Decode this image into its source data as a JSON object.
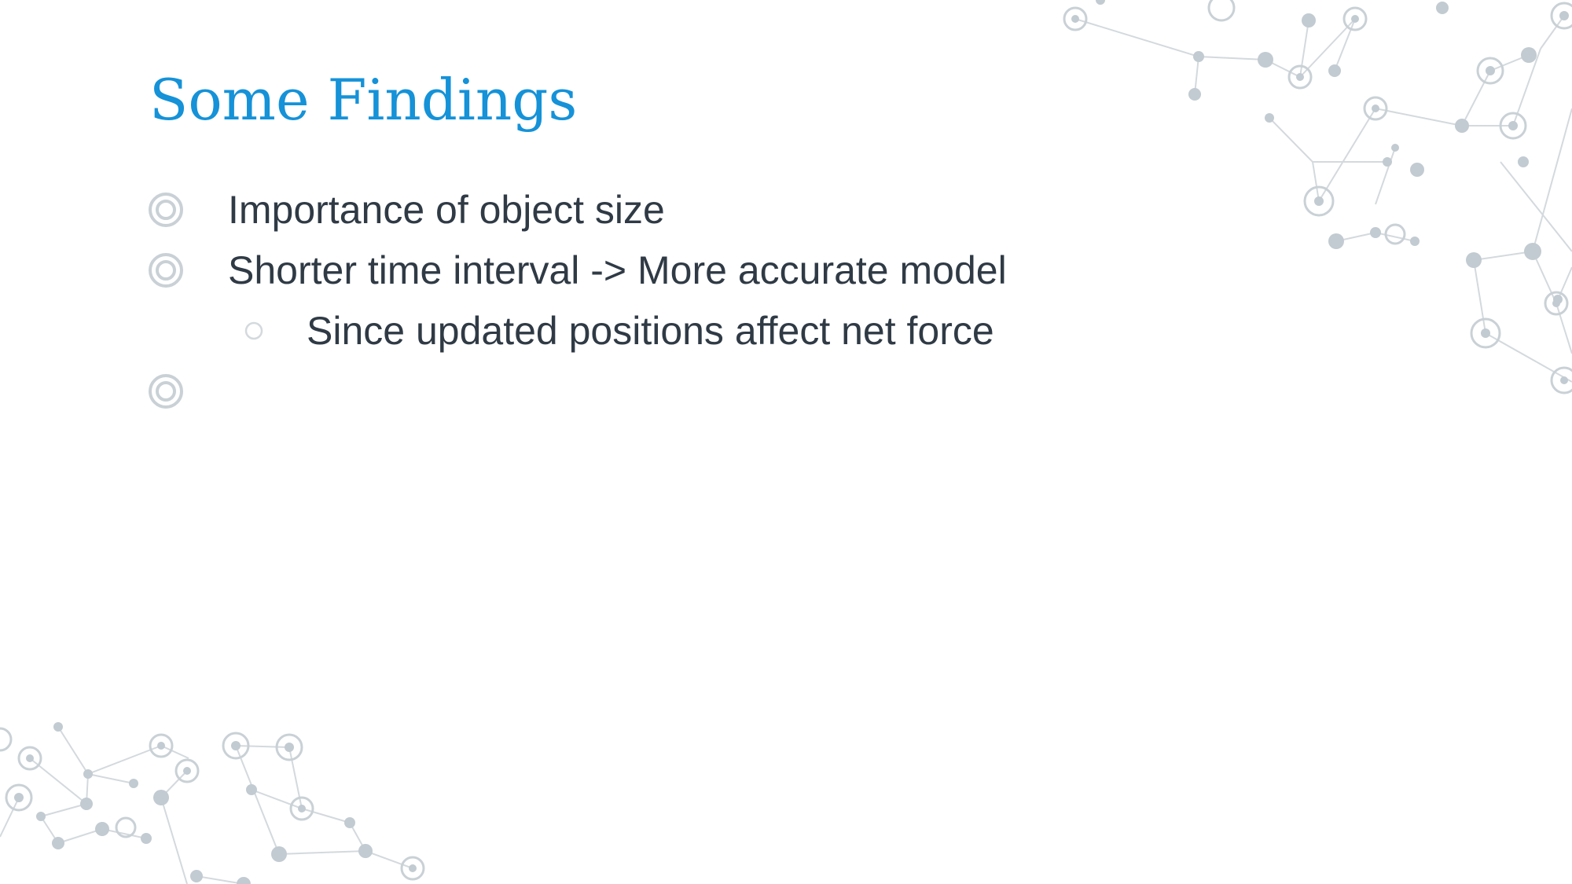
{
  "slide": {
    "title": "Some Findings",
    "bullets": [
      {
        "level": 1,
        "text": "Importance of object size"
      },
      {
        "level": 1,
        "text": "Shorter time interval -> More accurate model"
      },
      {
        "level": 2,
        "text": "Since updated positions affect net force"
      },
      {
        "level": 1,
        "text": ""
      }
    ]
  },
  "colors": {
    "title": "#1592d8",
    "body_text": "#2f3a45",
    "bullet_marker": "#c9d1d6",
    "network_decoration": "#b8c2c9"
  },
  "icons": {
    "level1_bullet": "double-ring-bullet-icon",
    "level2_bullet": "hollow-circle-bullet-icon",
    "decoration": "molecule-network-icon"
  }
}
